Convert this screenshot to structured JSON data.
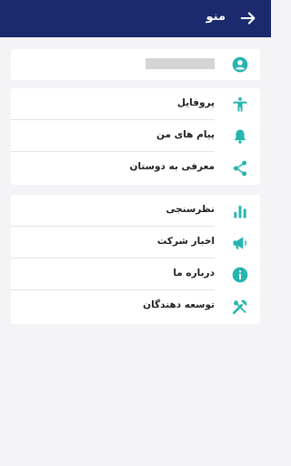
{
  "app": {
    "title": "منو",
    "accent": "#26b5b0",
    "header_color": "#1a2a6c"
  },
  "profile_card": {
    "user_name": ""
  },
  "group1": [
    {
      "label": "پروفایل",
      "icon": "accessibility-icon"
    },
    {
      "label": "پیام های من",
      "icon": "bell-icon"
    },
    {
      "label": "معرفی به دوستان",
      "icon": "share-icon"
    }
  ],
  "group2": [
    {
      "label": "نظرسنجی",
      "icon": "bar-chart-icon"
    },
    {
      "label": "اخبار شرکت",
      "icon": "megaphone-icon"
    },
    {
      "label": "درباره ما",
      "icon": "info-icon"
    },
    {
      "label": "توسعه دهندگان",
      "icon": "tools-icon"
    }
  ]
}
